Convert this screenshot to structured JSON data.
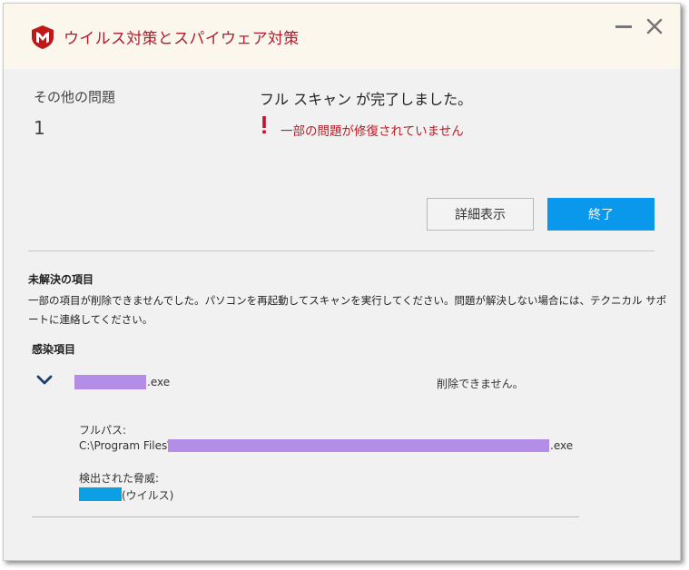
{
  "window": {
    "title": "ウイルス対策とスパイウェア対策"
  },
  "summary": {
    "other_issues_label": "その他の問題",
    "other_issues_count": "1",
    "scan_status": "フル スキャン が完了しました。",
    "warning": "一部の問題が修復されていません"
  },
  "actions": {
    "details_label": "詳細表示",
    "finish_label": "終了"
  },
  "unresolved": {
    "title": "未解決の項目",
    "description": "一部の項目が削除できませんでした。パソコンを再起動してスキャンを実行してください。問題が解決しない場合には、テクニカル サポートに連絡してください。"
  },
  "infected": {
    "title": "感染項目",
    "item": {
      "file_ext": ".exe",
      "status": "削除できません。",
      "full_path_label": "フルパス:",
      "full_path_prefix": "C:\\Program Files\\",
      "full_path_ext": ".exe",
      "threat_label": "検出された脅威:",
      "threat_type": "(ウイルス)"
    }
  },
  "colors": {
    "brand": "#b01c2e",
    "warning": "#b72029",
    "accent": "#0a98ec",
    "redaction_purple": "#b38de6",
    "redaction_blue": "#0aa0e3"
  }
}
